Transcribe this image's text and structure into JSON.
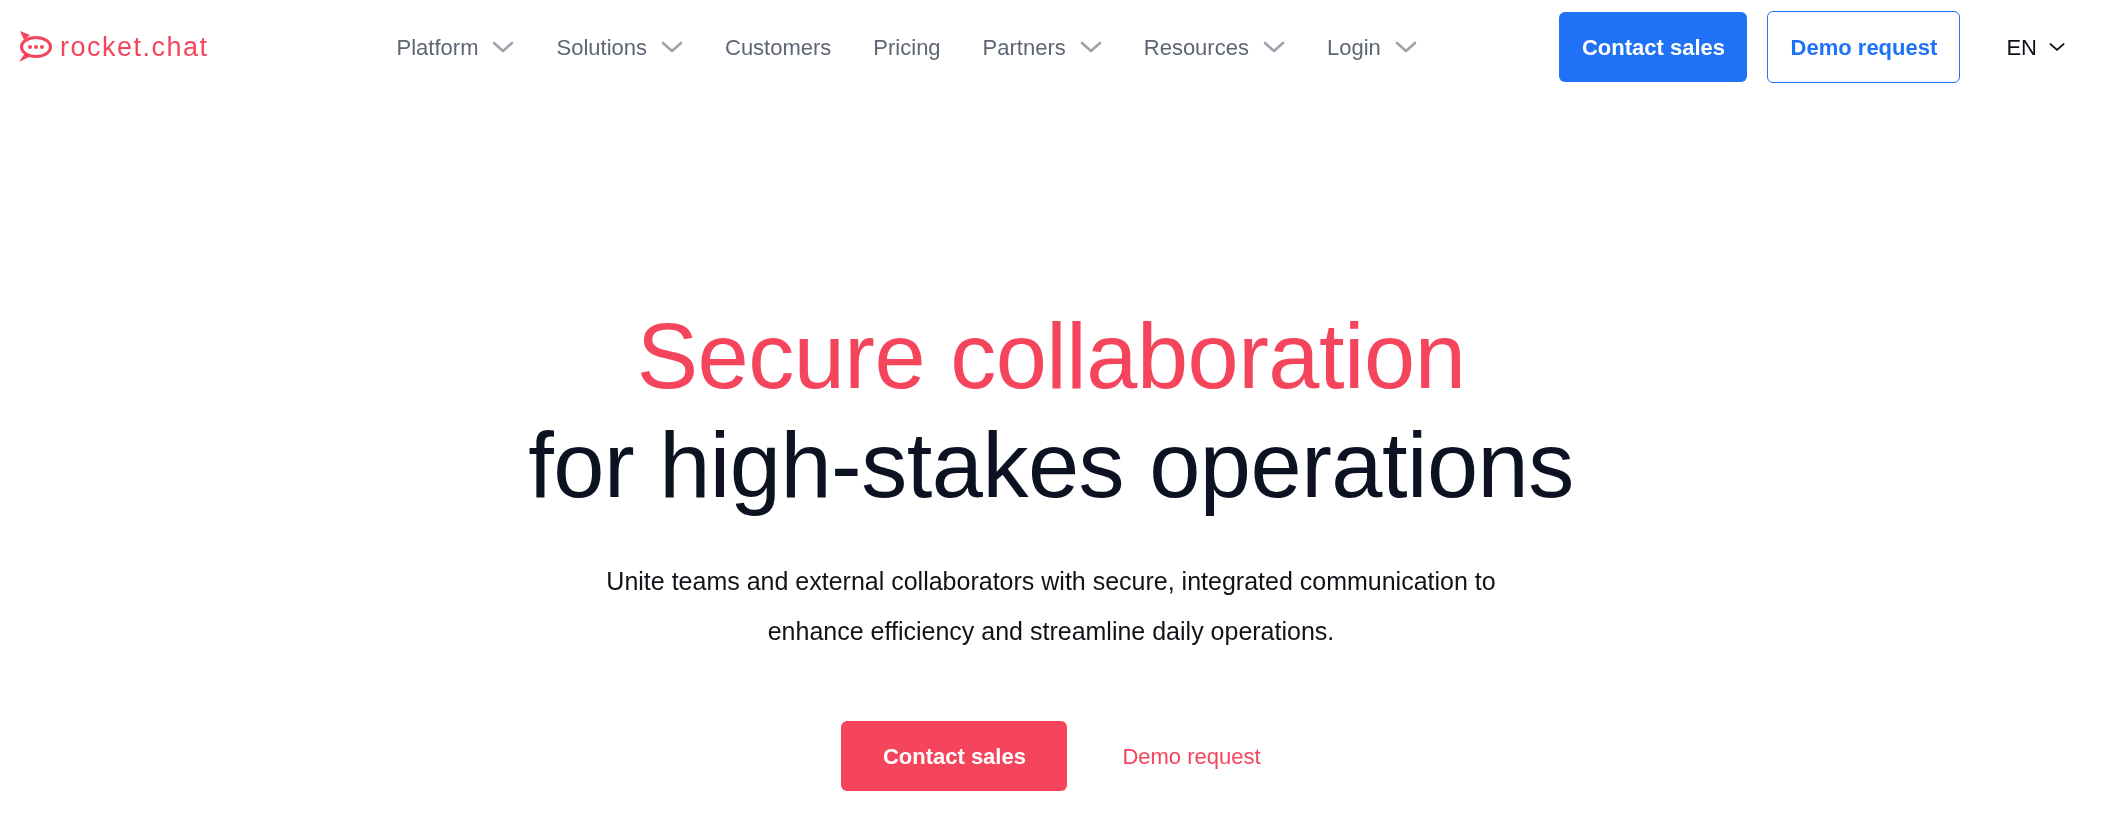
{
  "header": {
    "logo": {
      "text": "rocket.chat"
    },
    "nav": [
      {
        "label": "Platform",
        "dropdown": true
      },
      {
        "label": "Solutions",
        "dropdown": true
      },
      {
        "label": "Customers",
        "dropdown": false
      },
      {
        "label": "Pricing",
        "dropdown": false
      },
      {
        "label": "Partners",
        "dropdown": true
      },
      {
        "label": "Resources",
        "dropdown": true
      },
      {
        "label": "Login",
        "dropdown": true
      }
    ],
    "actions": [
      {
        "label": "Contact sales",
        "kind": "primary"
      },
      {
        "label": "Demo request",
        "kind": "outline"
      }
    ],
    "language": {
      "label": "EN"
    }
  },
  "hero": {
    "title_accent": "Secure collaboration",
    "title": "for high-stakes operations",
    "description": "Unite teams and external collaborators with secure, integrated communication to enhance efficiency and streamline daily operations.",
    "actions": [
      {
        "label": "Contact sales",
        "kind": "primary"
      },
      {
        "label": "Demo request",
        "kind": "link"
      }
    ]
  }
}
